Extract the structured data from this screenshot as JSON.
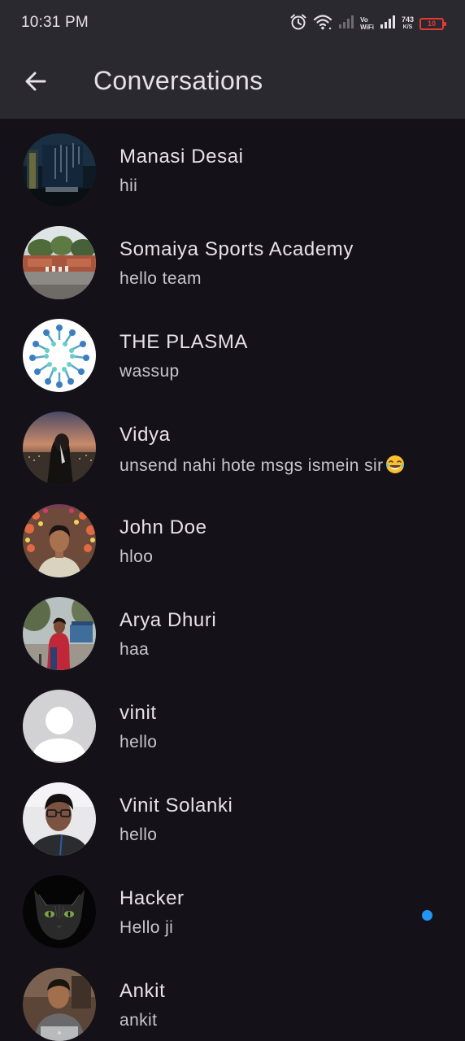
{
  "status_bar": {
    "time": "10:31 PM",
    "vowifi_top": "Vo",
    "vowifi_bottom": "WiFi",
    "net_speed_value": "743",
    "net_speed_unit": "K/S",
    "battery_level": "10",
    "icons": [
      "alarm-icon",
      "wifi-icon",
      "signal-icon",
      "vowifi-icon",
      "signal-icon",
      "net-speed",
      "battery-icon"
    ]
  },
  "app_bar": {
    "back_icon": "arrow-back-icon",
    "title": "Conversations"
  },
  "colors": {
    "background": "#141218",
    "app_bar": "#2b2930",
    "text_primary": "#e6e1e8",
    "text_secondary": "#c9c5cc",
    "unread_dot": "#2196f3",
    "battery_low": "#e53935"
  },
  "conversations": [
    {
      "name": "Manasi Desai",
      "last_message": "hii",
      "unread": false
    },
    {
      "name": "Somaiya Sports Academy",
      "last_message": "hello team",
      "unread": false
    },
    {
      "name": "THE PLASMA",
      "last_message": "wassup",
      "unread": false
    },
    {
      "name": "Vidya",
      "last_message": "unsend nahi hote msgs ismein sir",
      "emoji": "laughing-tears-emoji",
      "unread": false
    },
    {
      "name": "John Doe",
      "last_message": "hloo",
      "unread": false
    },
    {
      "name": "Arya Dhuri",
      "last_message": "haa",
      "unread": false
    },
    {
      "name": "vinit",
      "last_message": "hello",
      "unread": false
    },
    {
      "name": "Vinit Solanki",
      "last_message": "hello",
      "unread": false
    },
    {
      "name": "Hacker",
      "last_message": "Hello ji",
      "unread": true
    },
    {
      "name": "Ankit",
      "last_message": "ankit",
      "unread": false
    }
  ]
}
